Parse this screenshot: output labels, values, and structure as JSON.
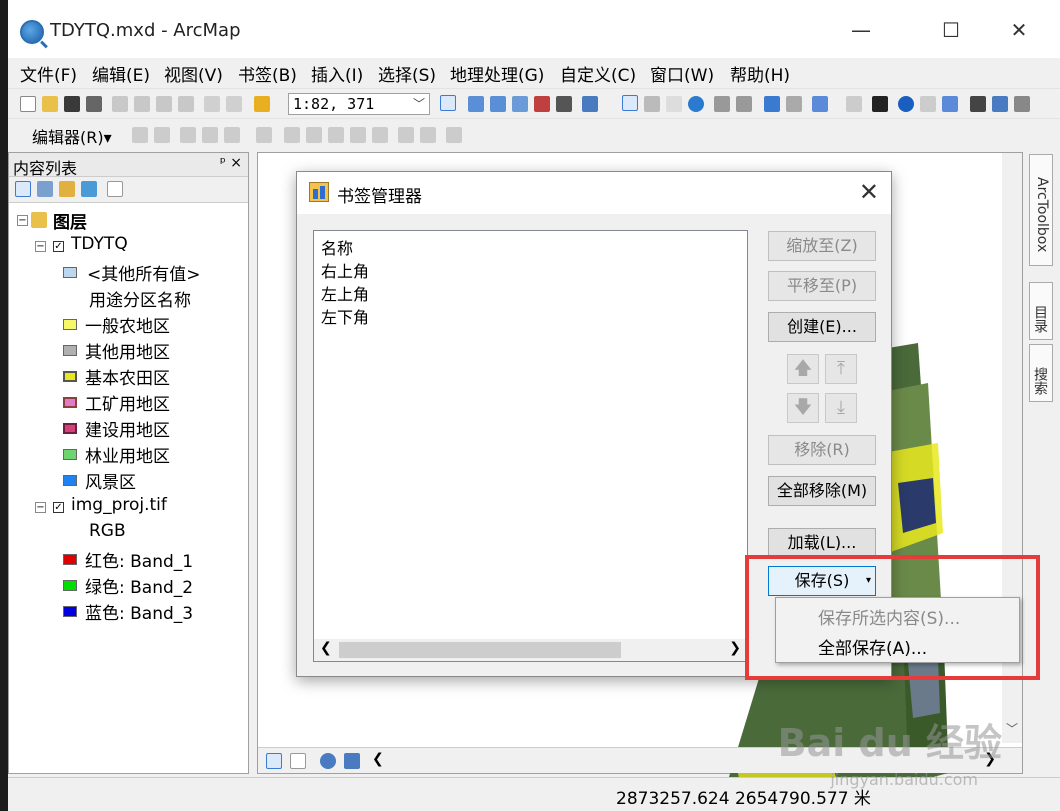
{
  "window": {
    "title": "TDYTQ.mxd - ArcMap"
  },
  "menu": [
    "文件(F)",
    "编辑(E)",
    "视图(V)",
    "书签(B)",
    "插入(I)",
    "选择(S)",
    "地理处理(G)",
    "自定义(C)",
    "窗口(W)",
    "帮助(H)"
  ],
  "toolbar": {
    "scale": "1:82, 371",
    "editor_label": "编辑器(R)▾"
  },
  "toc": {
    "title": "内容列表",
    "pin_label": "ᵖ ×",
    "root": "图层",
    "layers": [
      {
        "name": "TDYTQ",
        "items": [
          {
            "label": "<其他所有值>",
            "color": "#bcd6ef"
          },
          {
            "label": "用途分区名称",
            "color": ""
          },
          {
            "label": "一般农地区",
            "color": "#f7f76a"
          },
          {
            "label": "其他用地区",
            "color": "#b0b0b0"
          },
          {
            "label": "基本农田区",
            "color": "#e8e81e"
          },
          {
            "label": "工矿用地区",
            "color": "#e07cc5"
          },
          {
            "label": "建设用地区",
            "color": "#d4407a"
          },
          {
            "label": "林业用地区",
            "color": "#6ed46e"
          },
          {
            "label": "风景区",
            "color": "#1e82f0"
          }
        ]
      },
      {
        "name": "img_proj.tif",
        "items": [
          {
            "label": "RGB",
            "color": ""
          },
          {
            "label": "红色:   Band_1",
            "color": "#e00000"
          },
          {
            "label": "绿色: Band_2",
            "color": "#00dd00"
          },
          {
            "label": "蓝色:   Band_3",
            "color": "#0000e0"
          }
        ]
      }
    ]
  },
  "dialog": {
    "title": "书签管理器",
    "list_header": "名称",
    "bookmarks": [
      "右上角",
      "左上角",
      "左下角"
    ],
    "buttons": {
      "zoom_to": "缩放至(Z)",
      "pan_to": "平移至(P)",
      "create": "创建(E)...",
      "remove": "移除(R)",
      "remove_all": "全部移除(M)",
      "load": "加载(L)...",
      "save": "保存(S)"
    },
    "save_menu": [
      "保存所选内容(S)...",
      "全部保存(A)..."
    ]
  },
  "side_tabs": [
    "ArcToolbox",
    "目录",
    "搜索"
  ],
  "status": {
    "coords": "2873257.624  2654790.577 米"
  },
  "watermark": {
    "main": "Bai du 经验",
    "sub": "jingyan.baidu.com"
  }
}
